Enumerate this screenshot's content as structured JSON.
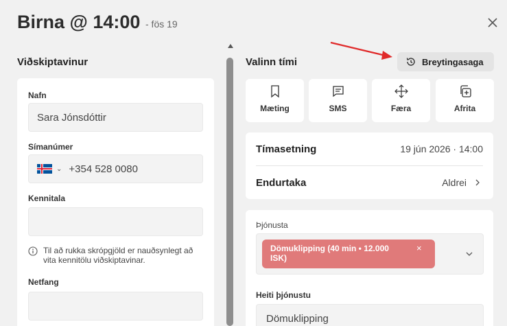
{
  "header": {
    "title": "Birna @ 14:00",
    "subtitle": "- fös 19"
  },
  "customer": {
    "section_title": "Viðskiptavinur",
    "name_label": "Nafn",
    "name_value": "Sara Jónsdóttir",
    "phone_label": "Símanúmer",
    "phone_value": "+354 528 0080",
    "kennitala_label": "Kennitala",
    "kennitala_value": "",
    "info_text": "Til að rukka skrópgjöld er nauðsynlegt að vita kennitölu viðskiptavinar.",
    "email_label": "Netfang",
    "email_value": ""
  },
  "appointment": {
    "section_title": "Valinn tími",
    "history_button": "Breytingasaga",
    "actions": [
      {
        "label": "Mæting",
        "icon": "bookmark-icon"
      },
      {
        "label": "SMS",
        "icon": "message-icon"
      },
      {
        "label": "Færa",
        "icon": "move-icon"
      },
      {
        "label": "Afrita",
        "icon": "copy-icon"
      }
    ],
    "time_label": "Tímasetning",
    "time_value": "19 jún 2026 · 14:00",
    "repeat_label": "Endurtaka",
    "repeat_value": "Aldrei"
  },
  "service": {
    "label": "Þjónusta",
    "chip_text": "Dömuklipping (40 min • 12.000 ISK)",
    "name_label": "Heiti þjónustu",
    "name_value": "Dömuklipping"
  },
  "colors": {
    "background": "#f1f1f1",
    "card": "#ffffff",
    "chip": "#e07a7a",
    "annotation_arrow": "#e02a2a"
  }
}
